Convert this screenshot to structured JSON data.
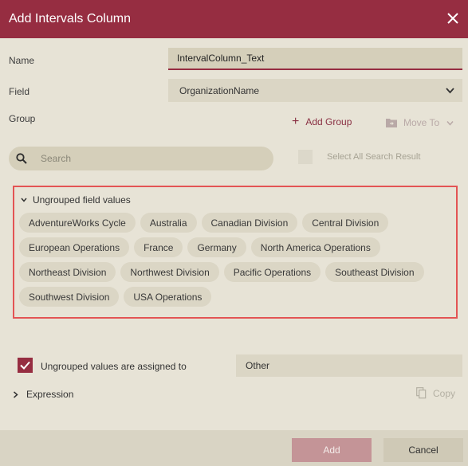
{
  "dialog": {
    "title": "Add Intervals Column",
    "close_icon": "close-icon"
  },
  "form": {
    "name_label": "Name",
    "name_value": "IntervalColumn_Text",
    "field_label": "Field",
    "field_value": "OrganizationName",
    "group_label": "Group"
  },
  "toolbar": {
    "add_group_label": "Add Group",
    "move_to_label": "Move To"
  },
  "search": {
    "placeholder": "Search",
    "select_all_label": "Select All Search Result"
  },
  "ungrouped": {
    "header": "Ungrouped field values",
    "rows": [
      [
        "AdventureWorks Cycle",
        "Australia",
        "Canadian Division",
        "Central Division"
      ],
      [
        "European Operations",
        "France",
        "Germany",
        "North America Operations"
      ],
      [
        "Northeast Division",
        "Northwest Division",
        "Pacific Operations",
        "Southeast Division"
      ],
      [
        "Southwest Division",
        "USA Operations"
      ]
    ]
  },
  "assign": {
    "label": "Ungrouped values are assigned to",
    "value": "Other",
    "checked": true
  },
  "expression": {
    "label": "Expression",
    "copy_label": "Copy"
  },
  "footer": {
    "add_label": "Add",
    "cancel_label": "Cancel"
  },
  "colors": {
    "accent": "#962d41",
    "background": "#e7e3d6",
    "highlight_border": "#e35454"
  }
}
